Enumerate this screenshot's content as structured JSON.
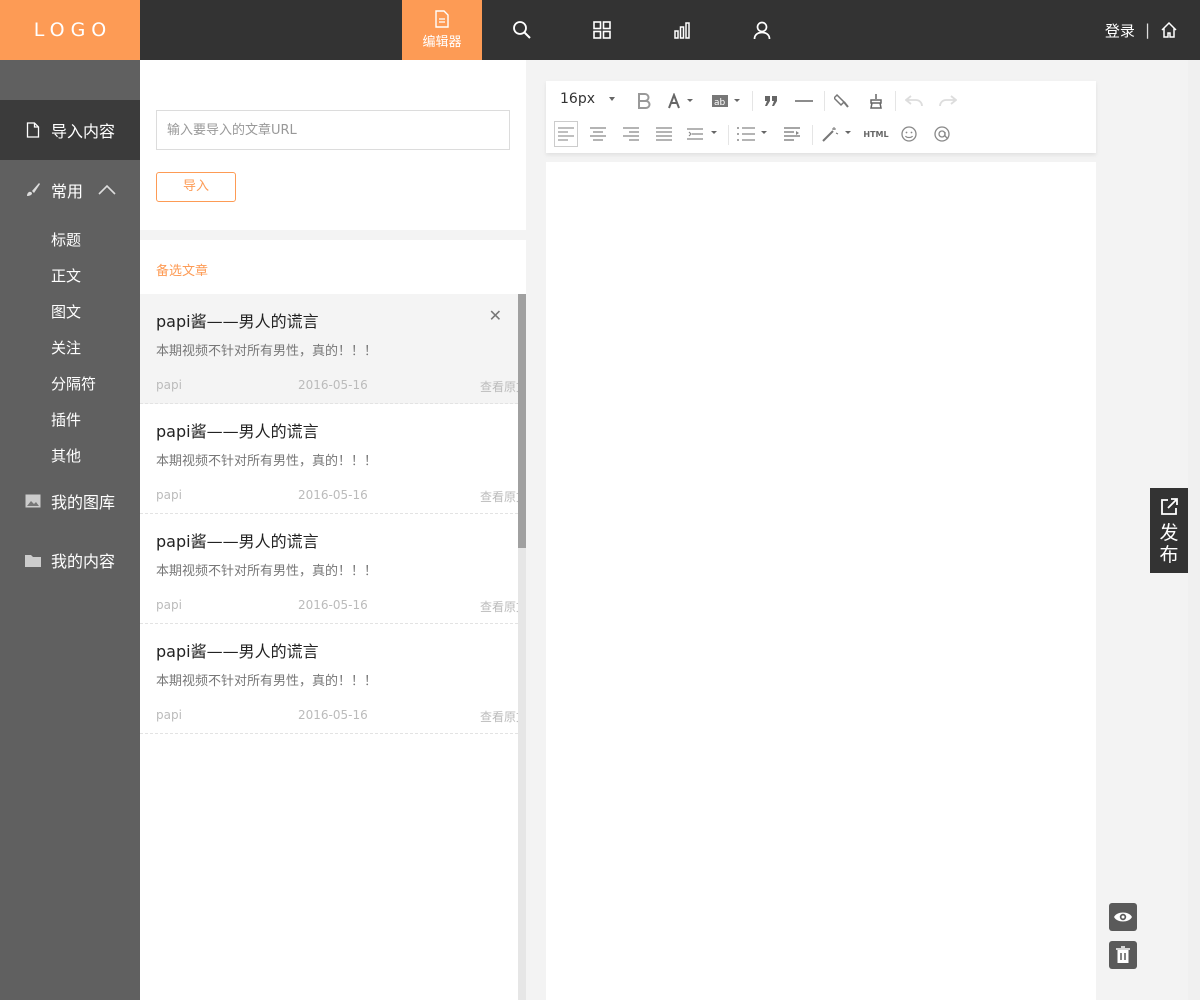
{
  "app": {
    "logo": "LOGO",
    "nav": [
      {
        "id": "editor",
        "label": "编辑器",
        "icon": "document-icon",
        "active": true
      },
      {
        "id": "search",
        "label": "",
        "icon": "search-icon"
      },
      {
        "id": "apps",
        "label": "",
        "icon": "grid-icon"
      },
      {
        "id": "stats",
        "label": "",
        "icon": "bar-chart-icon"
      },
      {
        "id": "user",
        "label": "",
        "icon": "user-icon"
      }
    ],
    "login": "登录",
    "separator": "|",
    "accent_color": "#fd9b55",
    "topbar_color": "#333333",
    "sidebar_color": "#606060"
  },
  "sidebar": {
    "items": [
      {
        "label": "导入内容",
        "icon": "document-icon",
        "active": true
      },
      {
        "label": "常用",
        "icon": "brush-icon",
        "expanded": true
      },
      {
        "label": "我的图库",
        "icon": "image-icon"
      },
      {
        "label": "我的内容",
        "icon": "folder-icon"
      }
    ],
    "sub_items": [
      "标题",
      "正文",
      "图文",
      "关注",
      "分隔符",
      "插件",
      "其他"
    ]
  },
  "import": {
    "placeholder": "输入要导入的文章URL",
    "value": "",
    "button": "导入"
  },
  "candidates": {
    "title": "备选文章",
    "articles": [
      {
        "title": "papi酱——男人的谎言",
        "desc": "本期视频不针对所有男性，真的！！！",
        "author": "papi",
        "date": "2016-05-16",
        "view": "查看原文"
      },
      {
        "title": "papi酱——男人的谎言",
        "desc": "本期视频不针对所有男性，真的！！！",
        "author": "papi",
        "date": "2016-05-16",
        "view": "查看原文"
      },
      {
        "title": "papi酱——男人的谎言",
        "desc": "本期视频不针对所有男性，真的！！！",
        "author": "papi",
        "date": "2016-05-16",
        "view": "查看原文"
      },
      {
        "title": "papi酱——男人的谎言",
        "desc": "本期视频不针对所有男性，真的！！！",
        "author": "papi",
        "date": "2016-05-16",
        "view": "查看原文"
      }
    ],
    "close_glyph": "✕"
  },
  "editor": {
    "font_size": "16px",
    "html_label": "HTML",
    "toolbar_icons": [
      "bold-icon",
      "font-color-icon",
      "background-color-icon",
      "blockquote-icon",
      "horizontal-rule-icon",
      "format-painter-icon",
      "clear-format-icon",
      "undo-icon",
      "redo-icon",
      "align-left-icon",
      "align-center-icon",
      "align-right-icon",
      "align-justify-icon",
      "line-height-icon",
      "list-icon",
      "indent-icon",
      "magic-icon",
      "html-icon",
      "emoji-icon",
      "at-icon"
    ]
  },
  "actions": {
    "publish": "发布",
    "preview_icon": "eye-icon",
    "delete_icon": "trash-icon"
  }
}
